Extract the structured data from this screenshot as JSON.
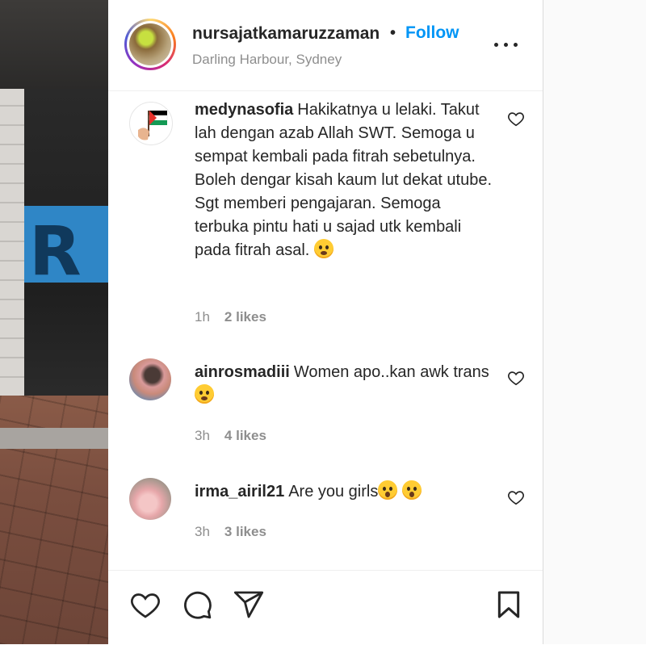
{
  "post": {
    "username": "nursajatkamaruzzaman",
    "separator": "•",
    "follow_label": "Follow",
    "location": "Darling Harbour, Sydney"
  },
  "photo": {
    "banner_text": "R"
  },
  "comments": [
    {
      "username": "medynasofia",
      "text": "Hakikatnya u lelaki. Takut lah dengan azab Allah SWT. Semoga u sempat kembali pada fitrah sebetulnya. Boleh dengar kisah kaum lut dekat utube. Sgt memberi pengajaran. Semoga terbuka pintu hati u sajad utk kembali pada fitrah asal.",
      "emoji": "sad-tear-emoji",
      "time": "1h",
      "likes": "2 likes"
    },
    {
      "username": "ainrosmadiii",
      "text": "Women apo..kan awk trans",
      "emoji": "laughing-tears-emoji",
      "time": "3h",
      "likes": "4 likes"
    },
    {
      "username": "irma_airil21",
      "text": "Are you girls",
      "emoji": "surprised-emoji",
      "time": "3h",
      "likes": "3 likes"
    }
  ],
  "icons": {
    "like": "heart-icon",
    "comment": "comment-icon",
    "share": "paper-plane-icon",
    "save": "bookmark-icon",
    "more": "more-options-icon"
  },
  "colors": {
    "accent": "#0095f6",
    "text": "#262626",
    "muted": "#8e8e8e"
  }
}
